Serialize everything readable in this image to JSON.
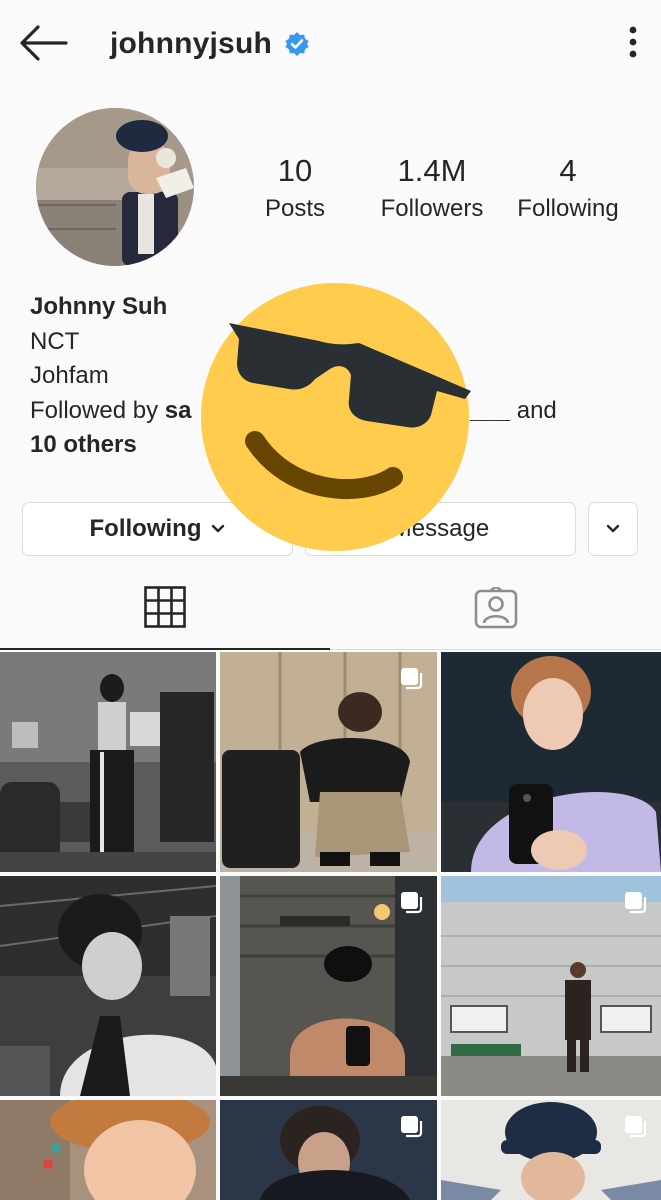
{
  "header": {
    "username": "johnnyjsuh",
    "back_icon": "arrow-left-icon",
    "verified_icon": "verified-badge-icon",
    "more_icon": "more-vertical-icon"
  },
  "profile": {
    "stats": [
      {
        "value": "10",
        "label": "Posts"
      },
      {
        "value": "1.4M",
        "label": "Followers"
      },
      {
        "value": "4",
        "label": "Following"
      }
    ],
    "bio": {
      "name": "Johnny Suh",
      "line1": "NCT",
      "line2": "Johfam",
      "followed_prefix": "Followed by ",
      "followed_partial_left": "sa",
      "followed_partial_right": "___",
      "followed_and": " and",
      "followed_others": "10 others"
    }
  },
  "actions": {
    "following_label": "Following",
    "message_label": "Message",
    "suggest_icon": "chevron-down-icon"
  },
  "tabs": [
    {
      "name": "posts-grid",
      "icon": "grid-icon",
      "active": true
    },
    {
      "name": "tagged",
      "icon": "tagged-person-icon",
      "active": false
    }
  ],
  "overlay": {
    "icon": "sunglasses-emoji-icon"
  },
  "colors": {
    "verified": "#3897f0",
    "text": "#262626",
    "border": "#dbdbdb",
    "emoji_face": "#ffcc4d",
    "emoji_glasses": "#292f33",
    "emoji_mouth": "#664500"
  }
}
